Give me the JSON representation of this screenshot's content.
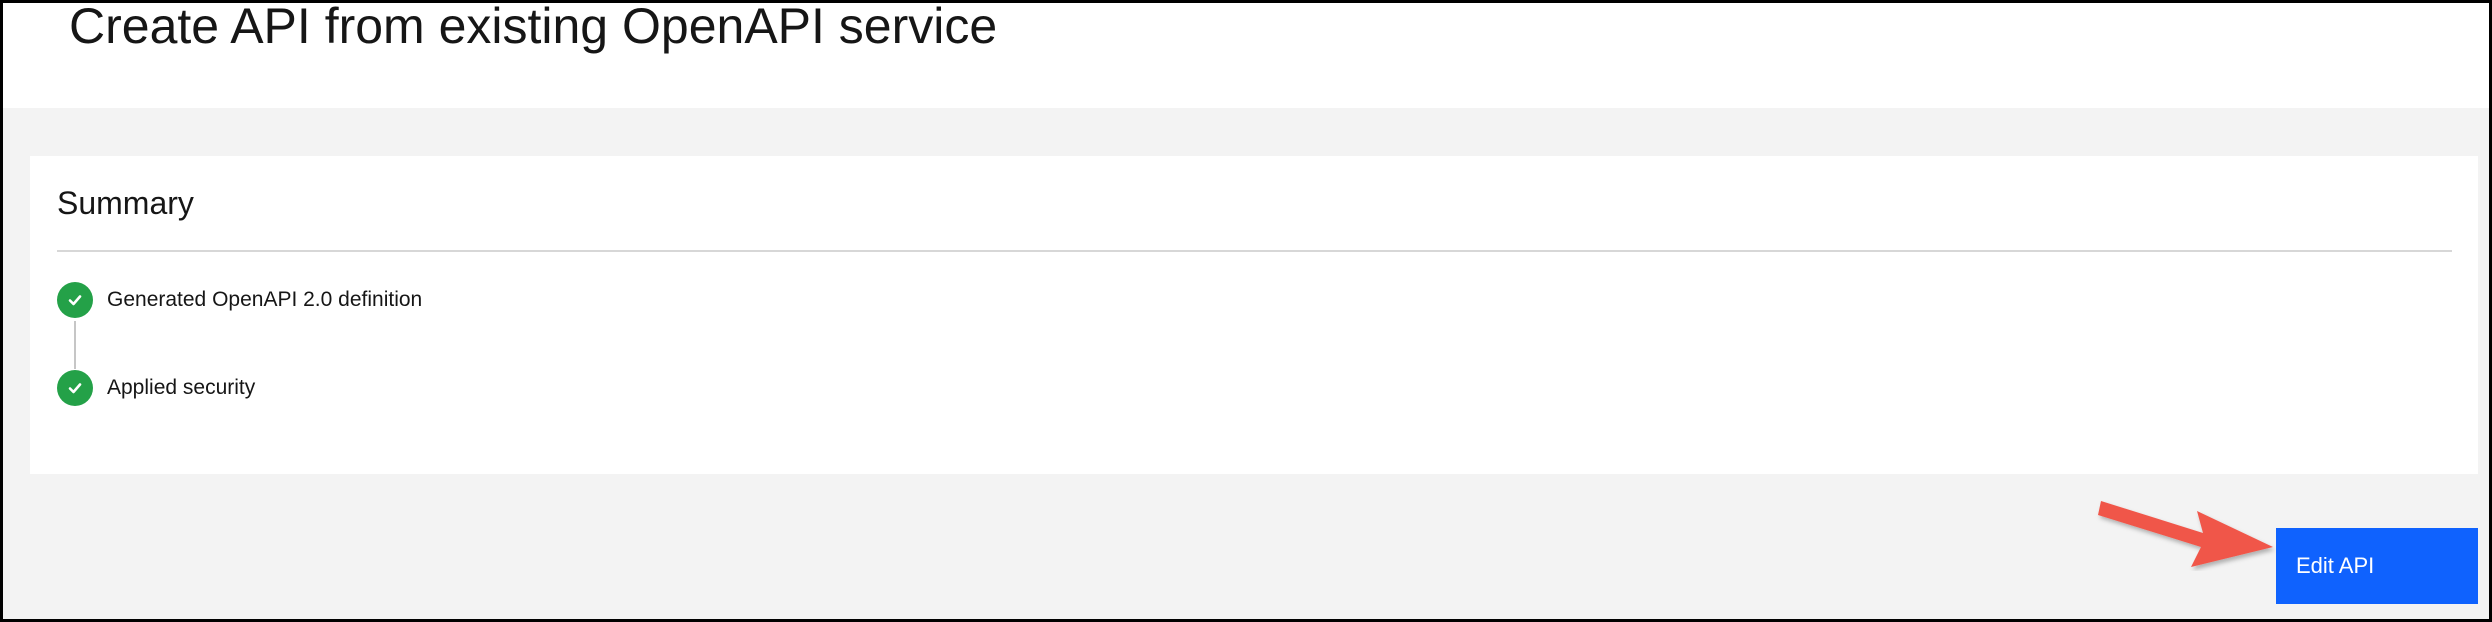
{
  "page": {
    "title": "Create API from existing OpenAPI service"
  },
  "summary": {
    "title": "Summary",
    "steps": [
      {
        "label": "Generated OpenAPI 2.0 definition",
        "icon": "checkmark-icon",
        "status": "complete"
      },
      {
        "label": "Applied security",
        "icon": "checkmark-icon",
        "status": "complete"
      }
    ]
  },
  "actions": {
    "edit_api_label": "Edit API"
  },
  "colors": {
    "accent": "#0f62fe",
    "success": "#24a148",
    "background": "#f3f3f3",
    "card": "#ffffff",
    "annotation_arrow": "#f0564a"
  }
}
